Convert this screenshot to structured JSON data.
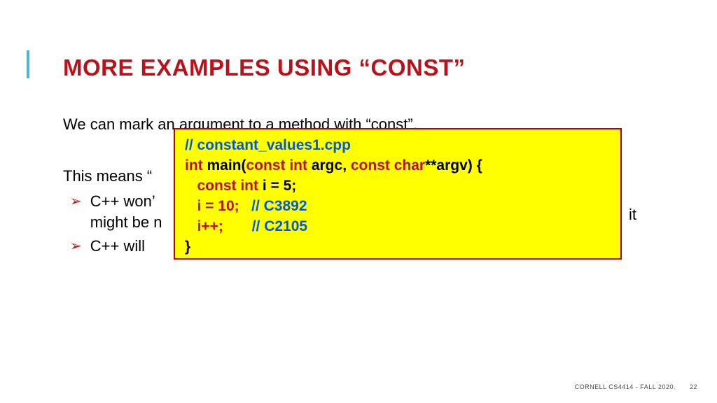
{
  "title": "MORE EXAMPLES USING “CONST”",
  "para1": "We can mark an argument to a method with “const”.",
  "para2": "This means “",
  "bullets": [
    {
      "a": "C++ won’",
      "b": "might be n"
    },
    {
      "a": "C++ will "
    }
  ],
  "right_frag": " it",
  "code": {
    "l1": "// constant_values1.cpp",
    "l2a": "int",
    "l2b": " main(",
    "l2c": "const int",
    "l2d": " argc, ",
    "l2e": "const char",
    "l2f": "**argv) {",
    "l3a": "   const int",
    "l3b": " i = 5;",
    "l4a": "   i = 10;   ",
    "l4b": "// C3892",
    "l5a": "   i++;       ",
    "l5b": "// C2105",
    "l6": "}"
  },
  "footer": {
    "course": "CORNELL CS4414 - FALL 2020.",
    "page": "22"
  }
}
